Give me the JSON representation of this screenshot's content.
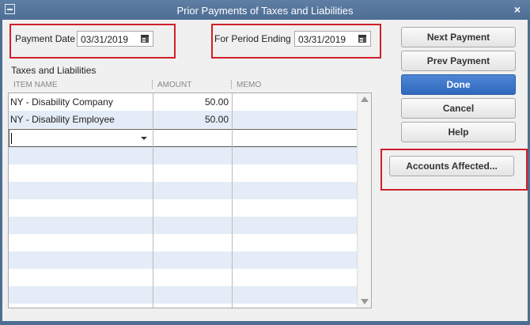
{
  "window": {
    "title": "Prior Payments of Taxes and Liabilities",
    "close_glyph": "×"
  },
  "payment_date": {
    "label": "Payment Date",
    "value": "03/31/2019"
  },
  "period_ending": {
    "label": "For Period Ending",
    "value": "03/31/2019"
  },
  "section_title": "Taxes and Liabilities",
  "columns": {
    "item_name": "ITEM NAME",
    "amount": "AMOUNT",
    "memo": "MEMO"
  },
  "rows": [
    {
      "item": "NY - Disability Company",
      "amount": "50.00",
      "memo": ""
    },
    {
      "item": "NY - Disability Employee",
      "amount": "50.00",
      "memo": ""
    }
  ],
  "buttons": {
    "next_payment": "Next Payment",
    "prev_payment": "Prev Payment",
    "done": "Done",
    "cancel": "Cancel",
    "help": "Help",
    "accounts_affected": "Accounts Affected..."
  },
  "colors": {
    "title_bar": "#4d6d94",
    "highlight_box": "#d0202a",
    "row_alt": "#e4ecf7",
    "primary_button": "#2f68bd"
  },
  "icons": [
    "system-menu-icon",
    "close-icon",
    "calendar-icon",
    "dropdown-arrow-icon",
    "scroll-up-icon",
    "scroll-down-icon"
  ]
}
